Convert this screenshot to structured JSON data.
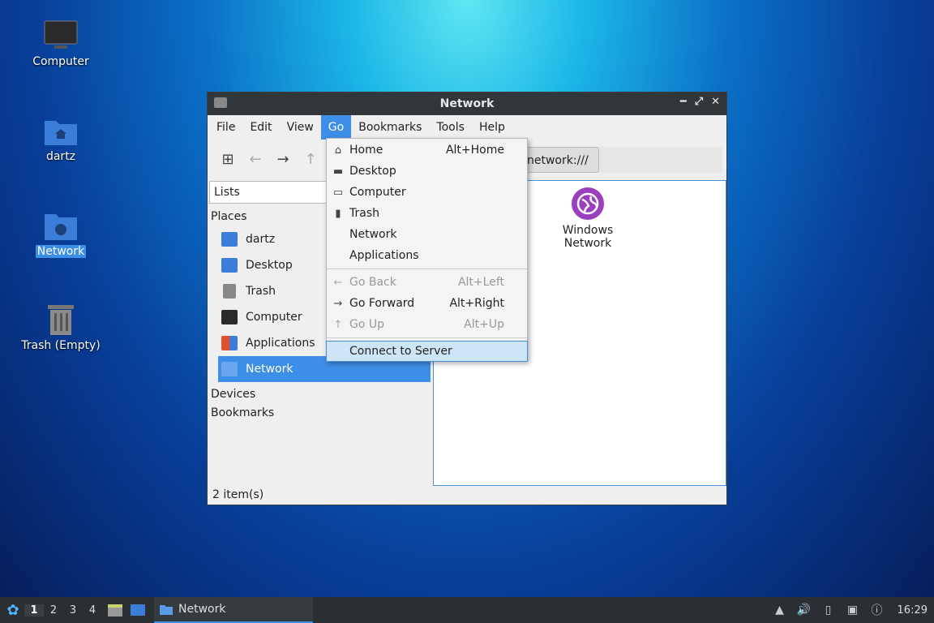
{
  "desktop": {
    "icons": [
      {
        "label": "Computer"
      },
      {
        "label": "dartz"
      },
      {
        "label": "Network"
      },
      {
        "label": "Trash (Empty)"
      }
    ]
  },
  "window": {
    "title": "Network",
    "menu": [
      "File",
      "Edit",
      "View",
      "Go",
      "Bookmarks",
      "Tools",
      "Help"
    ],
    "location_text": "network:///",
    "view_mode": "Lists",
    "sidebar": {
      "places_header": "Places",
      "items": [
        "dartz",
        "Desktop",
        "Trash",
        "Computer",
        "Applications",
        "Network"
      ],
      "devices_header": "Devices",
      "bookmarks_header": "Bookmarks"
    },
    "content": {
      "items": [
        "Windows Network"
      ]
    },
    "status": "2 item(s)"
  },
  "go_menu": {
    "items": [
      {
        "label": "Home",
        "shortcut": "Alt+Home"
      },
      {
        "label": "Desktop",
        "shortcut": ""
      },
      {
        "label": "Computer",
        "shortcut": ""
      },
      {
        "label": "Trash",
        "shortcut": ""
      },
      {
        "label": "Network",
        "shortcut": ""
      },
      {
        "label": "Applications",
        "shortcut": ""
      },
      {
        "label": "Go Back",
        "shortcut": "Alt+Left"
      },
      {
        "label": "Go Forward",
        "shortcut": "Alt+Right"
      },
      {
        "label": "Go Up",
        "shortcut": "Alt+Up"
      },
      {
        "label": "Connect to Server",
        "shortcut": ""
      }
    ]
  },
  "taskbar": {
    "workspaces": [
      "1",
      "2",
      "3",
      "4"
    ],
    "task_label": "Network",
    "clock": "16:29"
  },
  "colors": {
    "accent": "#3d8ee6",
    "titlebar": "#31363b",
    "taskbar": "#2b2f33"
  }
}
